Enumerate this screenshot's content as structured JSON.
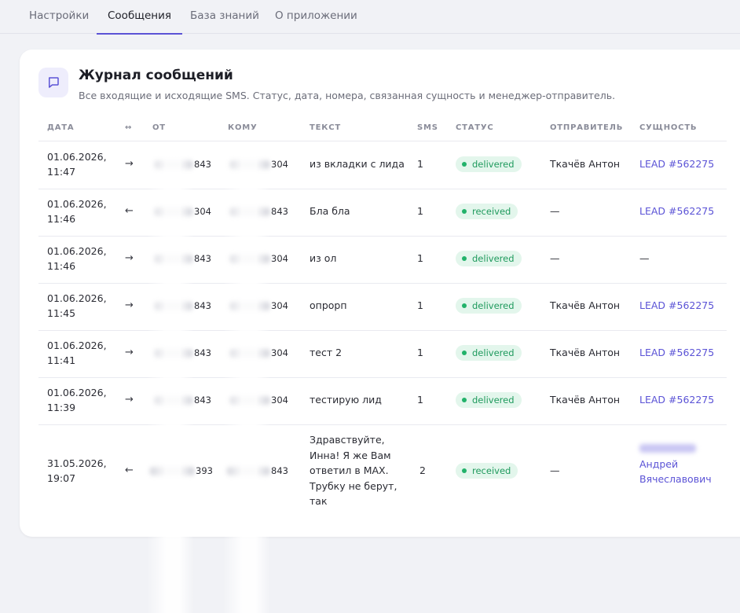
{
  "tabs": [
    {
      "label": "Настройки",
      "active": false
    },
    {
      "label": "Сообщения",
      "active": true
    },
    {
      "label": "База знаний",
      "active": false
    },
    {
      "label": "О приложении",
      "active": false
    }
  ],
  "header": {
    "icon": "chat-bubble-icon",
    "title": "Журнал сообщений",
    "subtitle": "Все входящие и исходящие SMS. Статус, дата, номера, связанная сущность и менеджер-отправитель."
  },
  "table": {
    "columns": [
      "ДАТА",
      "↔",
      "ОТ",
      "КОМУ",
      "ТЕКСТ",
      "SMS",
      "СТАТУС",
      "ОТПРАВИТЕЛЬ",
      "СУЩНОСТЬ"
    ],
    "rows": [
      {
        "date": "01.06.2026,",
        "time": "11:47",
        "dir": "→",
        "from_tail": "843",
        "to_tail": "304",
        "text": "из вкладки с лида",
        "sms": "1",
        "status": "delivered",
        "sender": "Ткачёв Антон",
        "entity": "LEAD #562275"
      },
      {
        "date": "01.06.2026,",
        "time": "11:46",
        "dir": "←",
        "from_tail": "304",
        "to_tail": "843",
        "text": "Бла бла",
        "sms": "1",
        "status": "received",
        "sender": "—",
        "entity": "LEAD #562275"
      },
      {
        "date": "01.06.2026,",
        "time": "11:46",
        "dir": "→",
        "from_tail": "843",
        "to_tail": "304",
        "text": "из ол",
        "sms": "1",
        "status": "delivered",
        "sender": "—",
        "entity": "—"
      },
      {
        "date": "01.06.2026,",
        "time": "11:45",
        "dir": "→",
        "from_tail": "843",
        "to_tail": "304",
        "text": "опрорп",
        "sms": "1",
        "status": "delivered",
        "sender": "Ткачёв Антон",
        "entity": "LEAD #562275"
      },
      {
        "date": "01.06.2026,",
        "time": "11:41",
        "dir": "→",
        "from_tail": "843",
        "to_tail": "304",
        "text": "тест 2",
        "sms": "1",
        "status": "delivered",
        "sender": "Ткачёв Антон",
        "entity": "LEAD #562275"
      },
      {
        "date": "01.06.2026,",
        "time": "11:39",
        "dir": "→",
        "from_tail": "843",
        "to_tail": "304",
        "text": "тестирую лид",
        "sms": "1",
        "status": "delivered",
        "sender": "Ткачёв Антон",
        "entity": "LEAD #562275"
      },
      {
        "date": "31.05.2026,",
        "time": "19:07",
        "dir": "←",
        "from_tail": "393",
        "to_tail": "843",
        "text": "Здравствуйте, Инна! Я же Вам ответил в MAX. Трубку не берут, так",
        "sms": "2",
        "status": "received",
        "sender": "—",
        "entity_line1": "Андрей",
        "entity_line2": "Вячеславович"
      }
    ]
  },
  "colors": {
    "accent": "#5b53d6",
    "status_green": "#22b26a",
    "status_bg": "#e3f6ec"
  }
}
